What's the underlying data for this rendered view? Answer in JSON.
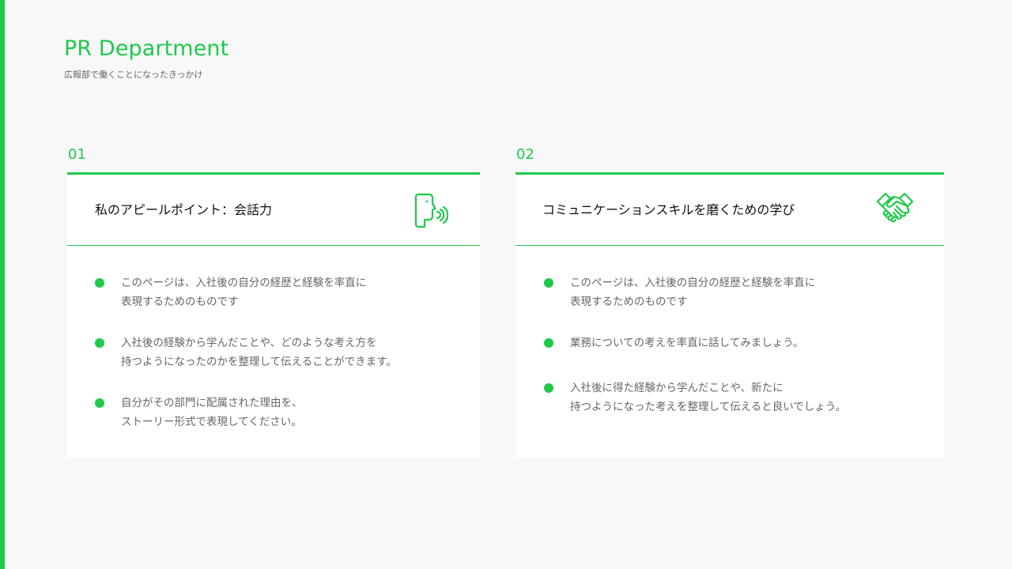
{
  "header": {
    "title": "PR Department",
    "subtitle": "広報部で働くことになったきっかけ"
  },
  "colors": {
    "accent": "#1ec94b",
    "background": "#f8f8f9",
    "card": "#ffffff",
    "body_text": "#666666"
  },
  "cards": [
    {
      "number": "01",
      "title": "私のアピールポイント：会話力",
      "icon": "speaking-person-icon",
      "bullets": [
        "このページは、入社後の自分の経歴と経験を率直に\n表現するためのものです",
        "入社後の経験から学んだことや、どのような考え方を\n持つようになったのかを整理して伝えることができます。",
        "自分がその部門に配属された理由を、\nストーリー形式で表現してください。"
      ]
    },
    {
      "number": "02",
      "title": "コミュニケーションスキルを磨くための学び",
      "icon": "handshake-icon",
      "bullets": [
        "このページは、入社後の自分の経歴と経験を率直に\n表現するためのものです",
        "業務についての考えを率直に話してみましょう。",
        "入社後に得た経験から学んだことや、新たに\n持つようになった考えを整理して伝えると良いでしょう。"
      ]
    }
  ]
}
